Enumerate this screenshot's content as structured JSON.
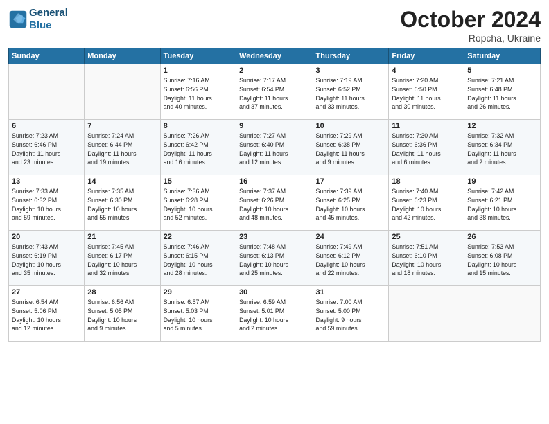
{
  "header": {
    "logo_line1": "General",
    "logo_line2": "Blue",
    "month": "October 2024",
    "location": "Ropcha, Ukraine"
  },
  "weekdays": [
    "Sunday",
    "Monday",
    "Tuesday",
    "Wednesday",
    "Thursday",
    "Friday",
    "Saturday"
  ],
  "weeks": [
    [
      {
        "num": "",
        "info": ""
      },
      {
        "num": "",
        "info": ""
      },
      {
        "num": "1",
        "info": "Sunrise: 7:16 AM\nSunset: 6:56 PM\nDaylight: 11 hours\nand 40 minutes."
      },
      {
        "num": "2",
        "info": "Sunrise: 7:17 AM\nSunset: 6:54 PM\nDaylight: 11 hours\nand 37 minutes."
      },
      {
        "num": "3",
        "info": "Sunrise: 7:19 AM\nSunset: 6:52 PM\nDaylight: 11 hours\nand 33 minutes."
      },
      {
        "num": "4",
        "info": "Sunrise: 7:20 AM\nSunset: 6:50 PM\nDaylight: 11 hours\nand 30 minutes."
      },
      {
        "num": "5",
        "info": "Sunrise: 7:21 AM\nSunset: 6:48 PM\nDaylight: 11 hours\nand 26 minutes."
      }
    ],
    [
      {
        "num": "6",
        "info": "Sunrise: 7:23 AM\nSunset: 6:46 PM\nDaylight: 11 hours\nand 23 minutes."
      },
      {
        "num": "7",
        "info": "Sunrise: 7:24 AM\nSunset: 6:44 PM\nDaylight: 11 hours\nand 19 minutes."
      },
      {
        "num": "8",
        "info": "Sunrise: 7:26 AM\nSunset: 6:42 PM\nDaylight: 11 hours\nand 16 minutes."
      },
      {
        "num": "9",
        "info": "Sunrise: 7:27 AM\nSunset: 6:40 PM\nDaylight: 11 hours\nand 12 minutes."
      },
      {
        "num": "10",
        "info": "Sunrise: 7:29 AM\nSunset: 6:38 PM\nDaylight: 11 hours\nand 9 minutes."
      },
      {
        "num": "11",
        "info": "Sunrise: 7:30 AM\nSunset: 6:36 PM\nDaylight: 11 hours\nand 6 minutes."
      },
      {
        "num": "12",
        "info": "Sunrise: 7:32 AM\nSunset: 6:34 PM\nDaylight: 11 hours\nand 2 minutes."
      }
    ],
    [
      {
        "num": "13",
        "info": "Sunrise: 7:33 AM\nSunset: 6:32 PM\nDaylight: 10 hours\nand 59 minutes."
      },
      {
        "num": "14",
        "info": "Sunrise: 7:35 AM\nSunset: 6:30 PM\nDaylight: 10 hours\nand 55 minutes."
      },
      {
        "num": "15",
        "info": "Sunrise: 7:36 AM\nSunset: 6:28 PM\nDaylight: 10 hours\nand 52 minutes."
      },
      {
        "num": "16",
        "info": "Sunrise: 7:37 AM\nSunset: 6:26 PM\nDaylight: 10 hours\nand 48 minutes."
      },
      {
        "num": "17",
        "info": "Sunrise: 7:39 AM\nSunset: 6:25 PM\nDaylight: 10 hours\nand 45 minutes."
      },
      {
        "num": "18",
        "info": "Sunrise: 7:40 AM\nSunset: 6:23 PM\nDaylight: 10 hours\nand 42 minutes."
      },
      {
        "num": "19",
        "info": "Sunrise: 7:42 AM\nSunset: 6:21 PM\nDaylight: 10 hours\nand 38 minutes."
      }
    ],
    [
      {
        "num": "20",
        "info": "Sunrise: 7:43 AM\nSunset: 6:19 PM\nDaylight: 10 hours\nand 35 minutes."
      },
      {
        "num": "21",
        "info": "Sunrise: 7:45 AM\nSunset: 6:17 PM\nDaylight: 10 hours\nand 32 minutes."
      },
      {
        "num": "22",
        "info": "Sunrise: 7:46 AM\nSunset: 6:15 PM\nDaylight: 10 hours\nand 28 minutes."
      },
      {
        "num": "23",
        "info": "Sunrise: 7:48 AM\nSunset: 6:13 PM\nDaylight: 10 hours\nand 25 minutes."
      },
      {
        "num": "24",
        "info": "Sunrise: 7:49 AM\nSunset: 6:12 PM\nDaylight: 10 hours\nand 22 minutes."
      },
      {
        "num": "25",
        "info": "Sunrise: 7:51 AM\nSunset: 6:10 PM\nDaylight: 10 hours\nand 18 minutes."
      },
      {
        "num": "26",
        "info": "Sunrise: 7:53 AM\nSunset: 6:08 PM\nDaylight: 10 hours\nand 15 minutes."
      }
    ],
    [
      {
        "num": "27",
        "info": "Sunrise: 6:54 AM\nSunset: 5:06 PM\nDaylight: 10 hours\nand 12 minutes."
      },
      {
        "num": "28",
        "info": "Sunrise: 6:56 AM\nSunset: 5:05 PM\nDaylight: 10 hours\nand 9 minutes."
      },
      {
        "num": "29",
        "info": "Sunrise: 6:57 AM\nSunset: 5:03 PM\nDaylight: 10 hours\nand 5 minutes."
      },
      {
        "num": "30",
        "info": "Sunrise: 6:59 AM\nSunset: 5:01 PM\nDaylight: 10 hours\nand 2 minutes."
      },
      {
        "num": "31",
        "info": "Sunrise: 7:00 AM\nSunset: 5:00 PM\nDaylight: 9 hours\nand 59 minutes."
      },
      {
        "num": "",
        "info": ""
      },
      {
        "num": "",
        "info": ""
      }
    ]
  ]
}
